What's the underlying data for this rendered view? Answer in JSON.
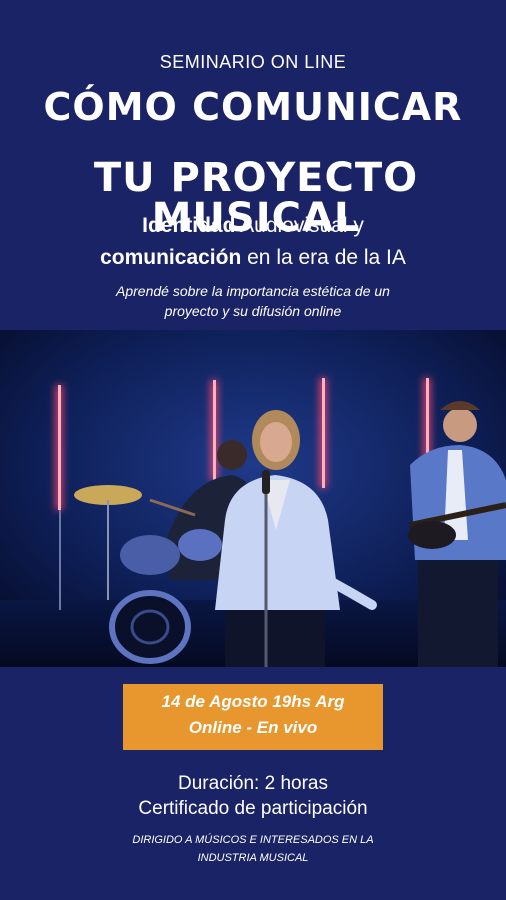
{
  "header": {
    "kicker": "SEMINARIO ON LINE",
    "title_line1": "CÓMO COMUNICAR",
    "title_line2": "TU PROYECTO MUSICAL"
  },
  "subtitle": {
    "line1_bold": "Identidad",
    "line1_rest": " Audiovisual y",
    "line2_bold": "comunicación",
    "line2_rest": " en la era de la IA"
  },
  "tagline": {
    "line1": "Aprendé sobre la importancia estética de un",
    "line2": "proyecto y su difusión online"
  },
  "event": {
    "date": "14 de Agosto 19hs Arg",
    "mode": "Online - En vivo"
  },
  "details": {
    "duration": "Duración: 2 horas",
    "certificate": "Certificado de participación"
  },
  "audience": {
    "line1": "DIRIGIDO A MÚSICOS  E INTERESADOS EN  LA",
    "line2": "INDUSTRIA MUSICAL"
  },
  "colors": {
    "background": "#1a2366",
    "accent": "#e8962e",
    "neon": "#ff4a6a"
  }
}
